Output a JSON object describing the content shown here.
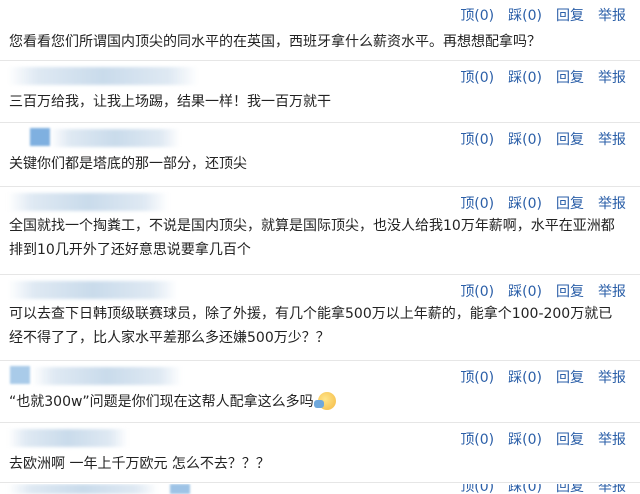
{
  "actions": {
    "up": "顶(0)",
    "down": "踩(0)",
    "reply": "回复",
    "report": "举报"
  },
  "comments": [
    {
      "text": "您看看您们所谓国内顶尖的同水平的在英国，西班牙拿什么薪资水平。再想想配拿吗？"
    },
    {
      "text": "三百万给我，让我上场踢，结果一样！我一百万就干"
    },
    {
      "text": "关键你们都是塔底的那一部分，还顶尖"
    },
    {
      "text": "全国就找一个掏粪工，不说是国内顶尖，就算是国际顶尖，也没人给我10万年薪啊，水平在亚洲都排到10几开外了还好意思说要拿几百个"
    },
    {
      "text": "可以去查下日韩顶级联赛球员，除了外援，有几个能拿500万以上年薪的，能拿个100-200万就已经不得了了，比人家水平差那么多还嫌500万少？？"
    },
    {
      "text": "“也就300w”问题是你们现在这帮人配拿这么多吗"
    },
    {
      "text": "去欧洲啊 一年上千万欧元 怎么不去？？？"
    }
  ]
}
